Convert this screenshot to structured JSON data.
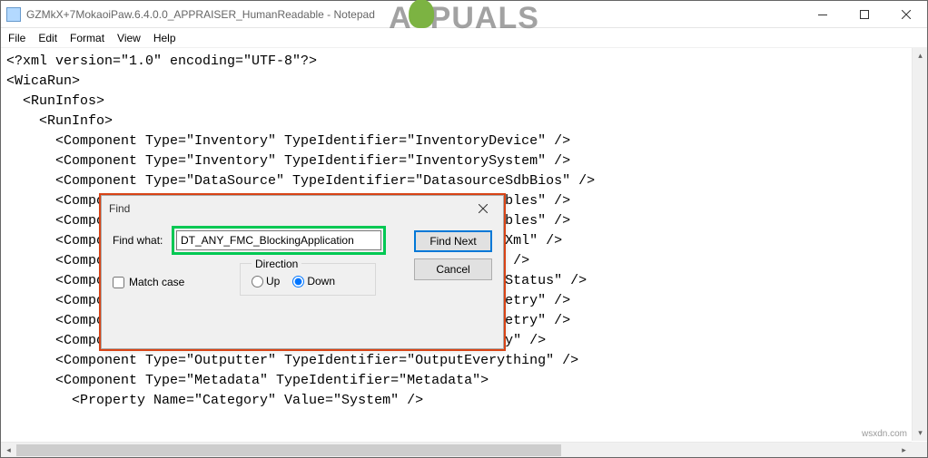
{
  "window": {
    "title": "GZMkX+7MokaoiPaw.6.4.0.0_APPRAISER_HumanReadable - Notepad"
  },
  "menu": {
    "file": "File",
    "edit": "Edit",
    "format": "Format",
    "view": "View",
    "help": "Help"
  },
  "editor": {
    "content": "<?xml version=\"1.0\" encoding=\"UTF-8\"?>\n<WicaRun>\n  <RunInfos>\n    <RunInfo>\n      <Component Type=\"Inventory\" TypeIdentifier=\"InventoryDevice\" />\n      <Component Type=\"Inventory\" TypeIdentifier=\"InventorySystem\" />\n      <Component Type=\"DataSource\" TypeIdentifier=\"DatasourceSdbBios\" />\n      <Component Type=\"DataSource\" TypeIdentifier=\"DecisionTables\" />\n      <Component Type=\"DataSource\" TypeIdentifier=\"DecisionTables\" />\n      <Component Type=\"Outputter\" TypeIdentifier=\"OutputSetupXml\" />\n      <Component Type=\"Outputter\" TypeIdentifier=\"OutputIcon\" />\n      <Component Type=\"Outputter\" TypeIdentifier=\"OutputSetupStatus\" />\n      <Component Type=\"Outputter\" TypeIdentifier=\"OutputTelemetry\" />\n      <Component Type=\"Outputter\" TypeIdentifier=\"OutputTelemetry\" />\n      <Component Type=\"Outputter\" TypeIdentifier=\"OutputBinary\" />\n      <Component Type=\"Outputter\" TypeIdentifier=\"OutputEverything\" />\n      <Component Type=\"Metadata\" TypeIdentifier=\"Metadata\">\n        <Property Name=\"Category\" Value=\"System\" />"
  },
  "find_dialog": {
    "title": "Find",
    "find_what_label": "Find what:",
    "find_what_value": "DT_ANY_FMC_BlockingApplication",
    "direction_label": "Direction",
    "up_label": "Up",
    "down_label": "Down",
    "match_case_label": "Match case",
    "find_next_label": "Find Next",
    "cancel_label": "Cancel"
  },
  "watermark": {
    "left": "A",
    "right": "PUALS"
  },
  "attribution": "wsxdn.com"
}
